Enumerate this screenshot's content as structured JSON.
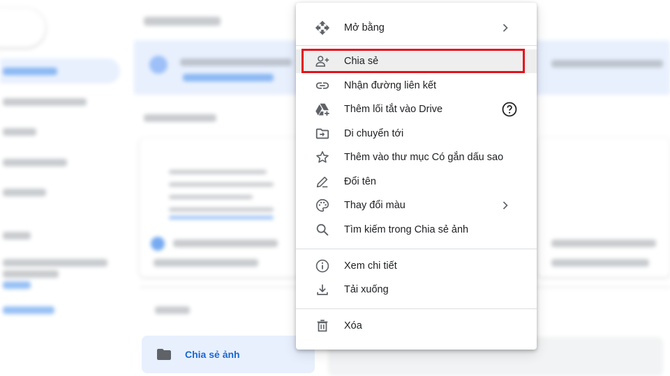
{
  "menu": {
    "items": [
      {
        "label": "Mở bằng",
        "icon": "open-with-icon",
        "submenu": true
      },
      {
        "label": "Chia sẻ",
        "icon": "share-person-add-icon",
        "highlighted": true
      },
      {
        "label": "Nhận đường liên kết",
        "icon": "link-icon"
      },
      {
        "label": "Thêm lối tắt vào Drive",
        "icon": "add-shortcut-drive-icon",
        "help_icon": "help-circle-icon"
      },
      {
        "label": "Di chuyển tới",
        "icon": "move-to-folder-icon"
      },
      {
        "label": "Thêm vào thư mục Có gắn dấu sao",
        "icon": "star-outline-icon"
      },
      {
        "label": "Đổi tên",
        "icon": "rename-pencil-icon"
      },
      {
        "label": "Thay đổi màu",
        "icon": "palette-icon",
        "submenu": true
      },
      {
        "label": "Tìm kiếm trong Chia sẻ ảnh",
        "icon": "search-icon"
      },
      {
        "label": "Xem chi tiết",
        "icon": "info-icon"
      },
      {
        "label": "Tải xuống",
        "icon": "download-icon"
      },
      {
        "label": "Xóa",
        "icon": "trash-icon"
      }
    ]
  },
  "folder": {
    "name": "Chia sẻ ảnh",
    "icon": "folder-icon"
  },
  "colors": {
    "highlight_border": "#e5101a",
    "folder_text": "#1967d2",
    "folder_tile_bg": "#e8f0fe"
  }
}
